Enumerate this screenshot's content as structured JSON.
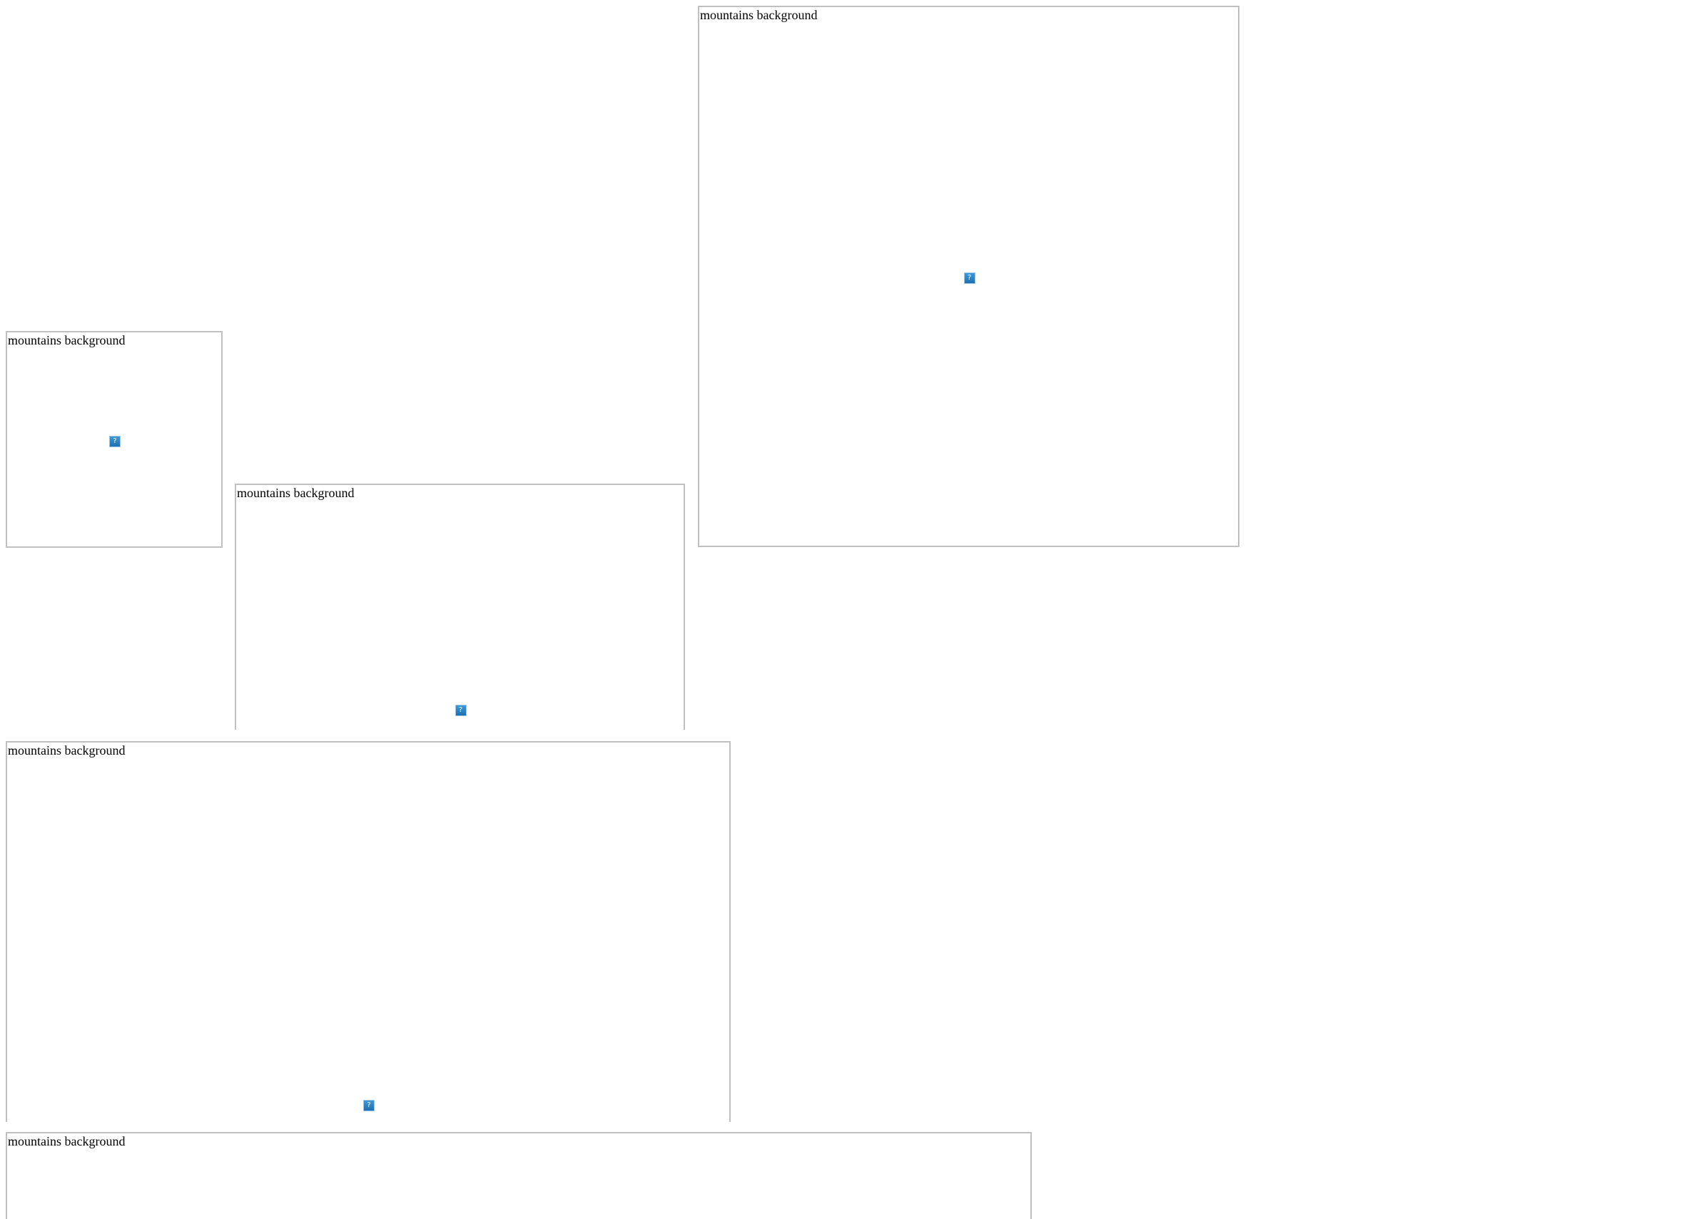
{
  "images": [
    {
      "alt": "mountains background",
      "icon": "broken-image-icon",
      "icon_glyph": "?"
    },
    {
      "alt": "mountains background",
      "icon": "broken-image-icon",
      "icon_glyph": "?"
    },
    {
      "alt": "mountains background",
      "icon": "broken-image-icon",
      "icon_glyph": "?"
    },
    {
      "alt": "mountains background",
      "icon": "broken-image-icon",
      "icon_glyph": "?"
    },
    {
      "alt": "mountains background",
      "icon": "broken-image-icon",
      "icon_glyph": "?"
    }
  ],
  "colors": {
    "border": "#c0c0c0",
    "icon": "#2a86c8",
    "background": "#ffffff"
  }
}
